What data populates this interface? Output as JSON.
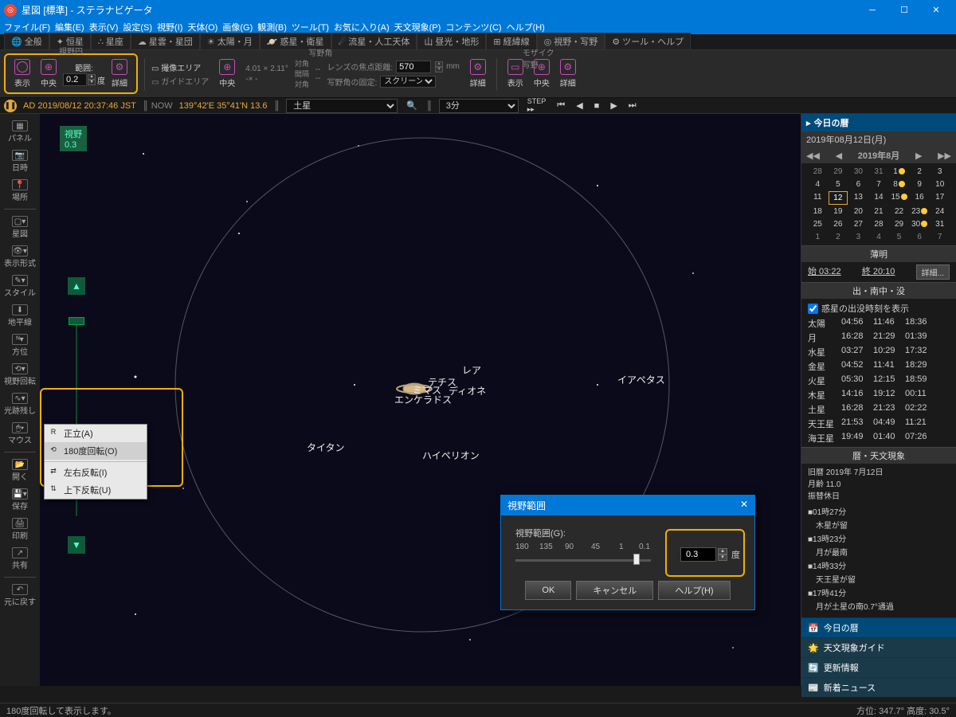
{
  "titlebar": {
    "title": "星図 [標準] - ステラナビゲータ"
  },
  "menubar": [
    "ファイル(F)",
    "編集(E)",
    "表示(V)",
    "設定(S)",
    "視野(I)",
    "天体(O)",
    "画像(G)",
    "観測(B)",
    "ツール(T)",
    "お気に入り(A)",
    "天文現象(P)",
    "コンテンツ(C)",
    "ヘルプ(H)"
  ],
  "ribbontabs": [
    {
      "icon": "🌐",
      "label": "全般"
    },
    {
      "icon": "✦",
      "label": "恒星"
    },
    {
      "icon": "∴",
      "label": "星座"
    },
    {
      "icon": "☁",
      "label": "星雲・星団"
    },
    {
      "icon": "☀",
      "label": "太陽・月"
    },
    {
      "icon": "🪐",
      "label": "惑星・衛星"
    },
    {
      "icon": "☄",
      "label": "流星・人工天体"
    },
    {
      "icon": "⼭",
      "label": "昼光・地形"
    },
    {
      "icon": "⊞",
      "label": "経緯線"
    },
    {
      "icon": "◎",
      "label": "視野・写野",
      "active": true
    },
    {
      "icon": "⚙",
      "label": "ツール・ヘルプ"
    }
  ],
  "ribbon": {
    "fov": {
      "title": "視野円",
      "show": "表示",
      "center": "中央",
      "range": "範囲:",
      "value": "0.2",
      "unit": "度",
      "detail": "詳細"
    },
    "photo": {
      "title": "写野角",
      "shoot": "撮像エリア",
      "guide": "ガイドエリア",
      "center": "中央",
      "dims": "4.01 × 2.11°",
      "taikaku": "対角\n間隔\n対角",
      "dash": "-×    -",
      "focal": "レンズの焦点距離:",
      "focal_val": "570",
      "mm": "mm",
      "fix": "写野角の固定:",
      "fixsel": "スクリーン",
      "detail": "詳細"
    },
    "mosaic": {
      "title": "モザイク写野",
      "show": "表示",
      "center": "中央",
      "detail": "詳細"
    }
  },
  "status": {
    "date": "AD 2019/08/12 20:37:46 JST",
    "coords": "139°42'E 35°41'N 13.6",
    "target": "土星",
    "step": "3分"
  },
  "sidetools": [
    {
      "icon": "▦",
      "label": "パネル"
    },
    {
      "icon": "📷",
      "label": "日時"
    },
    {
      "icon": "📍",
      "label": "場所"
    },
    {
      "sep": true
    },
    {
      "icon": "▢▾",
      "label": "星図"
    },
    {
      "icon": "👁▾",
      "label": "表示形式"
    },
    {
      "icon": "✎▾",
      "label": "スタイル"
    },
    {
      "icon": "⬇",
      "label": "地平線"
    },
    {
      "icon": "ᴺ▾",
      "label": "方位"
    },
    {
      "icon": "⟲▾",
      "label": "視野回転"
    },
    {
      "icon": "∿▾",
      "label": "光跡残し"
    },
    {
      "icon": "🖱▾",
      "label": "マウス"
    },
    {
      "sep": true
    },
    {
      "icon": "📂",
      "label": "開く"
    },
    {
      "icon": "💾▾",
      "label": "保存"
    },
    {
      "icon": "🖨",
      "label": "印刷"
    },
    {
      "icon": "↗",
      "label": "共有"
    },
    {
      "sep": true
    },
    {
      "icon": "↶",
      "label": "元に戻す"
    }
  ],
  "sky": {
    "fov_badge": "視野\n0.3",
    "moons": {
      "rhea": "レア",
      "tethys": "テチス",
      "mimas": "ミマス",
      "dione": "ディオネ",
      "enceladus": "エンケラドス",
      "titan": "タイタン",
      "hyperion": "ハイペリオン",
      "iapetus": "イアペタス"
    }
  },
  "ctxmenu": [
    {
      "icon": "R",
      "label": "正立(A)"
    },
    {
      "icon": "⟲",
      "label": "180度回転(O)",
      "hover": true
    },
    {
      "sep": true
    },
    {
      "icon": "⇄",
      "label": "左右反転(I)"
    },
    {
      "icon": "⇅",
      "label": "上下反転(U)"
    }
  ],
  "dialog": {
    "title": "視野範囲",
    "label": "視野範囲(G):",
    "ticks": [
      "180",
      "135",
      "90",
      "45",
      "1",
      "0.1"
    ],
    "value": "0.3",
    "unit": "度",
    "ok": "OK",
    "cancel": "キャンセル",
    "help": "ヘルプ(H)"
  },
  "right": {
    "title": "今日の暦",
    "date": "2019年08月12日(月)",
    "cal_title": "2019年8月",
    "cal_days": [
      [
        "28",
        "29",
        "30",
        "31",
        "1",
        "2",
        "3"
      ],
      [
        "4",
        "5",
        "6",
        "7",
        "8",
        "9",
        "10"
      ],
      [
        "11",
        "12",
        "13",
        "14",
        "15",
        "16",
        "17"
      ],
      [
        "18",
        "19",
        "20",
        "21",
        "22",
        "23",
        "24"
      ],
      [
        "25",
        "26",
        "27",
        "28",
        "29",
        "30",
        "31"
      ],
      [
        "1",
        "2",
        "3",
        "4",
        "5",
        "6",
        "7"
      ]
    ],
    "twilight": {
      "title": "薄明",
      "start": "始 03:22",
      "end": "終 20:10",
      "detail": "詳細..."
    },
    "riseset": {
      "title": "出・南中・没",
      "chk": "惑星の出没時刻を表示",
      "rows": [
        [
          "太陽",
          "04:56",
          "11:46",
          "18:36"
        ],
        [
          "月",
          "16:28",
          "21:29",
          "01:39"
        ],
        [
          "水星",
          "03:27",
          "10:29",
          "17:32"
        ],
        [
          "金星",
          "04:52",
          "11:41",
          "18:29"
        ],
        [
          "火星",
          "05:30",
          "12:15",
          "18:59"
        ],
        [
          "木星",
          "14:16",
          "19:12",
          "00:11"
        ],
        [
          "土星",
          "16:28",
          "21:23",
          "02:22"
        ],
        [
          "天王星",
          "21:53",
          "04:49",
          "11:21"
        ],
        [
          "海王星",
          "19:49",
          "01:40",
          "07:26"
        ]
      ]
    },
    "events": {
      "title": "暦・天文現象",
      "header": [
        "旧暦 2019年 7月12日",
        "月齢 11.0",
        "振替休日"
      ],
      "items": [
        "■01時27分",
        "　木星が留",
        "■13時23分",
        "　月が最南",
        "■14時33分",
        "　天王星が留",
        "■17時41分",
        "　月が土星の南0.7°通過"
      ]
    },
    "tabs": [
      {
        "icon": "📅",
        "label": "今日の暦",
        "active": true
      },
      {
        "icon": "🌟",
        "label": "天文現象ガイド"
      },
      {
        "icon": "🔄",
        "label": "更新情報"
      },
      {
        "icon": "📰",
        "label": "新着ニュース"
      }
    ]
  },
  "bottom": {
    "hint": "180度回転して表示します。",
    "coords": "方位: 347.7° 高度: 30.5°"
  }
}
